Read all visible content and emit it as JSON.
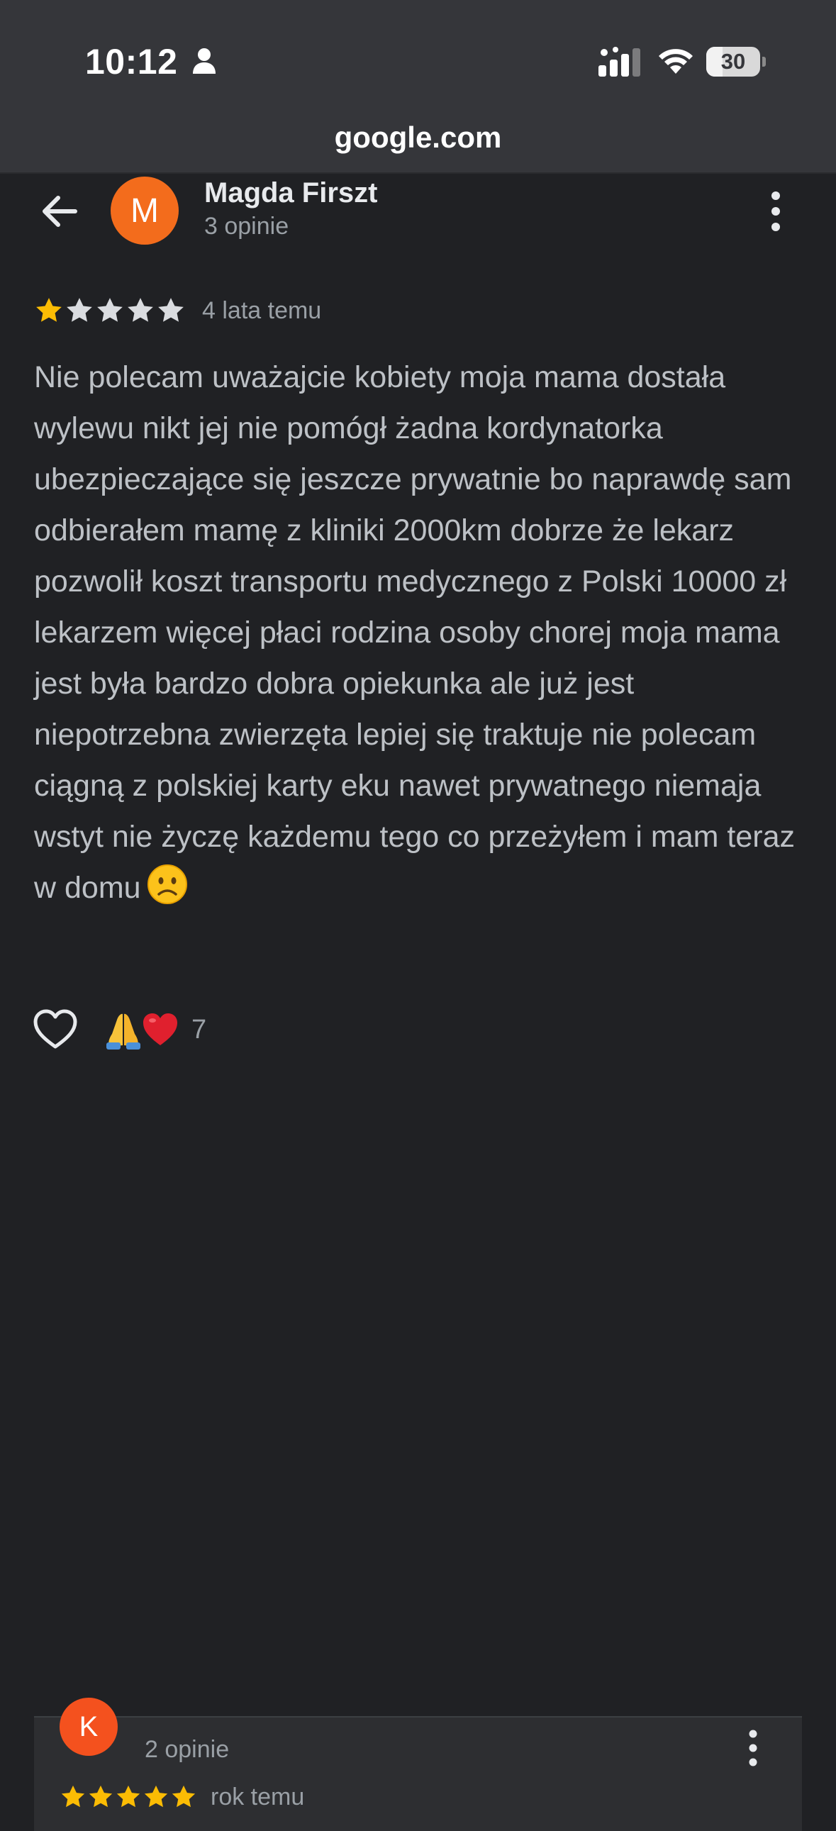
{
  "status_bar": {
    "time": "10:12",
    "battery": "30",
    "battery_fraction": 0.3,
    "icons": [
      "person-icon",
      "cellular-signal-icon",
      "wifi-icon",
      "battery-icon"
    ]
  },
  "browser": {
    "url": "google.com"
  },
  "review": {
    "avatar_letter": "M",
    "avatar_color": "#f36c1c",
    "name": "Magda Firszt",
    "review_count": "3 opinie",
    "rating": 1,
    "max_rating": 5,
    "date": "4 lata temu",
    "text": "Nie polecam uważajcie kobiety moja mama dostała wylewu nikt jej nie pomógł żadna kordynatorka ubezpieczające się jeszcze prywatnie bo naprawdę sam odbierałem mamę z kliniki 2000km dobrze że lekarz pozwolił koszt transportu medycznego z Polski 10000 zł lekarzem więcej płaci rodzina osoby chorej moja mama jest była bardzo dobra opiekunka ale już jest niepotrzebna zwierzęta lepiej się traktuje nie polecam ciągną z polskiej karty eku nawet prywatnego niemaja wstyt nie życzę każdemu tego co przeżyłem i mam teraz w domu",
    "reactions": {
      "emoji_icons": [
        "folded-hands-icon",
        "red-heart-icon"
      ],
      "count": "7"
    }
  },
  "next_review": {
    "avatar_letter": "K",
    "avatar_color": "#f4511e",
    "review_count": "2 opinie",
    "rating": 5,
    "max_rating": 5,
    "date": "rok temu"
  },
  "colors": {
    "background": "#202124",
    "chrome": "#35363a",
    "star_filled": "#fbbc04",
    "star_empty": "#dadce0",
    "secondary_text": "#9aa0a6"
  }
}
